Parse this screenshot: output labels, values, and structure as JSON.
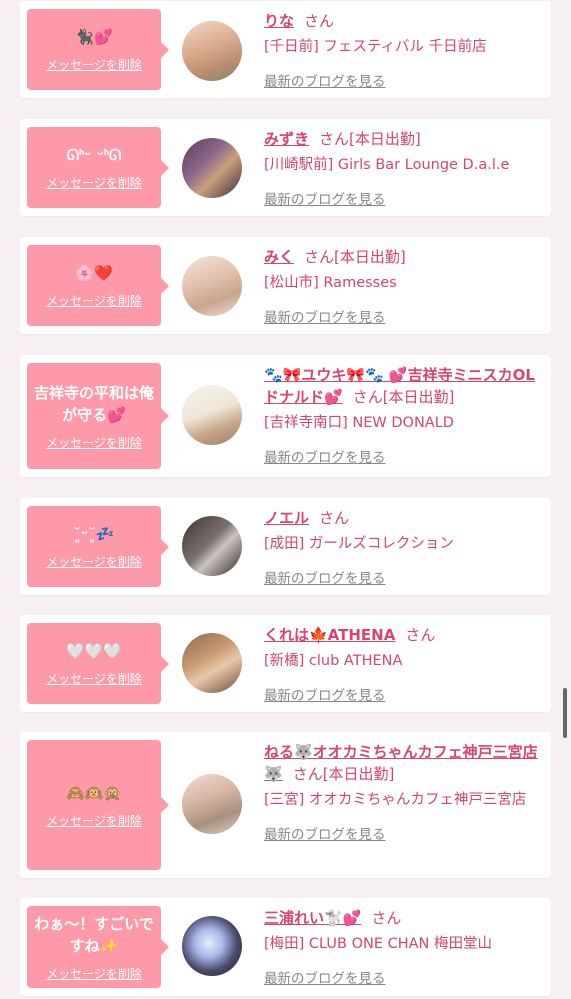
{
  "delete_label": "メッセージを削除",
  "blog_label": "最新のブログを見る",
  "cards": [
    {
      "message": "🐈‍⬛💕",
      "name": "りな",
      "suffix": "さん",
      "shop": "[千日前] フェスティバル 千日前店"
    },
    {
      "message": "ᘏᑋᵕ ᵕᑋᘏ",
      "name": "みずき",
      "suffix": "さん[本日出勤]",
      "shop": "[川崎駅前] Girls Bar Lounge D.a.l.e"
    },
    {
      "message": "🌸❤️",
      "name": "みく",
      "suffix": "さん[本日出勤]",
      "shop": "[松山市] Ramesses"
    },
    {
      "message": "吉祥寺の平和は俺が守る💕",
      "name": "🐾🎀ユウキ🎀🐾 💕吉祥寺ミニスカOLドナルド💕",
      "suffix": "さん[本日出勤]",
      "shop": "[吉祥寺南口] NEW DONALD"
    },
    {
      "message": "˘͈ᵕ˘͈💤",
      "name": "ノエル",
      "suffix": "さん",
      "shop": "[成田] ガールズコレクション"
    },
    {
      "message": "🤍🤍🤍",
      "name": "くれは🍁ATHENA",
      "suffix": "さん",
      "shop": "[新橋] club ATHENA"
    },
    {
      "message": "🙈🙉🙊",
      "name": "ねる🐺オオカミちゃんカフェ神戸三宮店🐺",
      "suffix": "さん[本日出勤]",
      "shop": "[三宮] オオカミちゃんカフェ神戸三宮店"
    },
    {
      "message": "わぁ〜！すごいですね✨",
      "name": "三浦れい🐩💕",
      "suffix": "さん",
      "shop": "[梅田] CLUB ONE CHAN 梅田堂山"
    }
  ]
}
